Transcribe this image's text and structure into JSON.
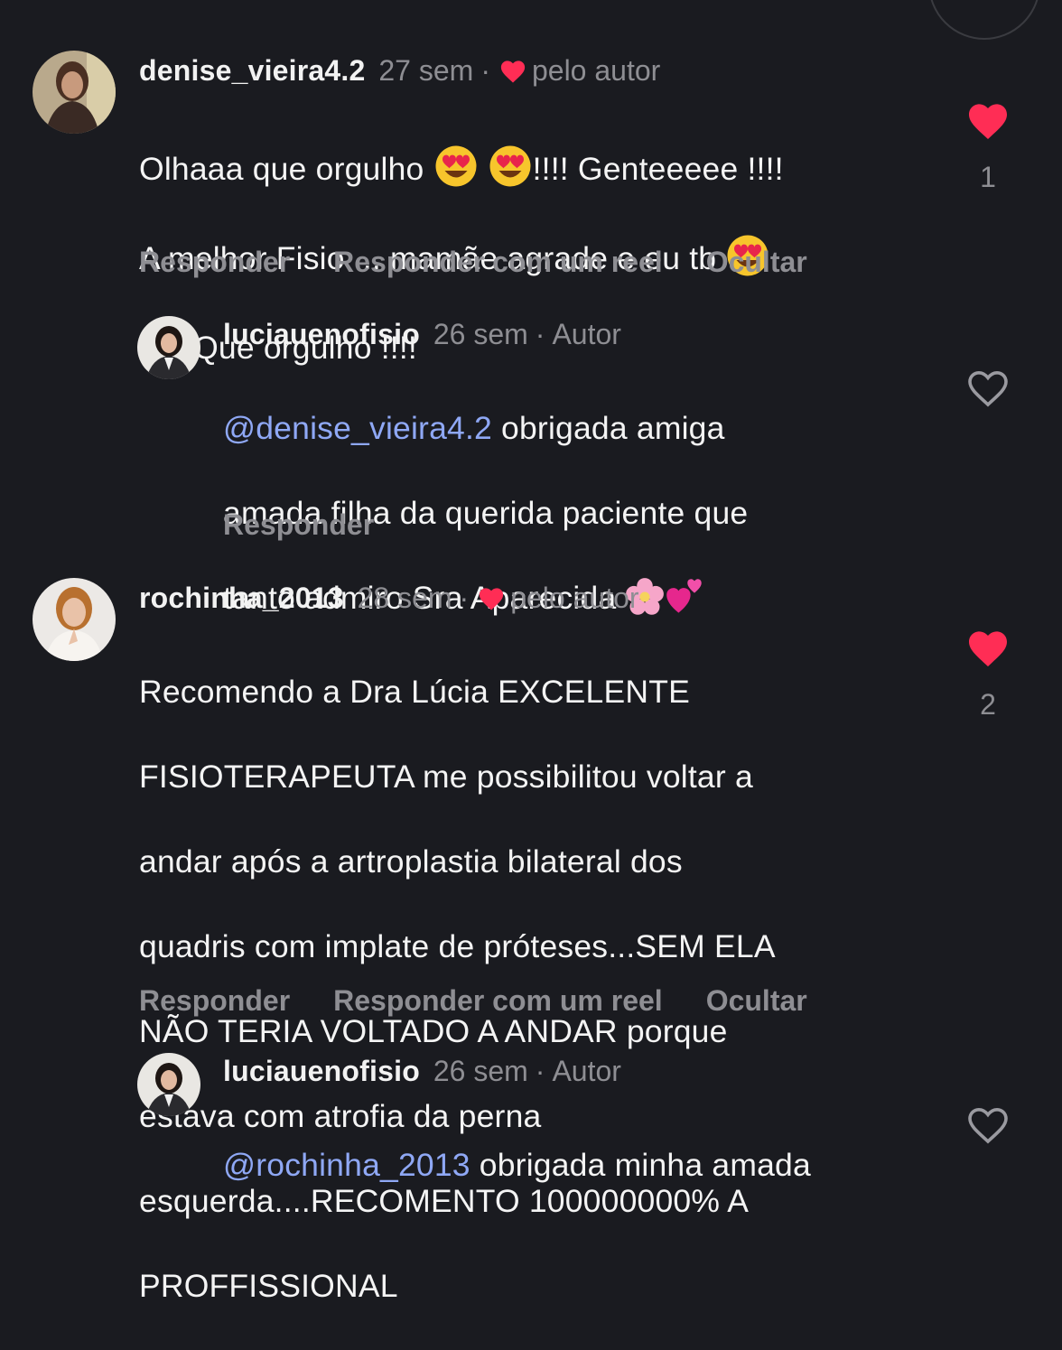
{
  "comments": [
    {
      "username": "denise_vieira4.2",
      "time": "27 sem",
      "badge": "pelo autor",
      "lines": [
        "Olhaaa que orgulho ",
        "!!!! Genteeeee !!!!",
        "A melhor Fisio ... mamãe agrade e eu tb ",
        " Que orgulho !!!!"
      ],
      "actions": [
        "Responder",
        "Responder com um reel",
        "Ocultar"
      ],
      "likes": "1",
      "liked": true
    },
    {
      "username": "luciauenofisio",
      "time": "26 sem",
      "badge": "Autor",
      "mention": "@denise_vieira4.2",
      "lines": [
        " obrigada amiga",
        "amada filha da querida paciente que",
        "tanto admiro Sra Aparecida "
      ],
      "actions": [
        "Responder"
      ],
      "liked": false
    },
    {
      "username": "rochinha_2013",
      "time": "28 sem",
      "badge": "pelo autor",
      "lines": [
        "Recomendo a Dra Lúcia EXCELENTE",
        "FISIOTERAPEUTA me possibilitou voltar a",
        "andar após a artroplastia bilateral dos",
        "quadris com implate de próteses...SEM ELA",
        "NÃO TERIA VOLTADO A ANDAR porque",
        "estava com atrofia da perna",
        "esquerda....RECOMENTO 100000000% A",
        "PROFFISSIONAL"
      ],
      "actions": [
        "Responder",
        "Responder com um reel",
        "Ocultar"
      ],
      "likes": "2",
      "liked": true
    },
    {
      "username": "luciauenofisio",
      "time": "26 sem",
      "badge": "Autor",
      "mention": "@rochinha_2013",
      "lines": [
        " obrigada minha amada"
      ],
      "liked": false
    }
  ],
  "colors": {
    "background": "#1a1b20",
    "heart": "#ff2d55",
    "mention": "#8fa8f5",
    "muted": "#8e8e93"
  },
  "icons": [
    "heart-filled-icon",
    "heart-outline-icon",
    "heart-eyes-emoji",
    "cherry-blossom-emoji",
    "two-hearts-emoji"
  ]
}
